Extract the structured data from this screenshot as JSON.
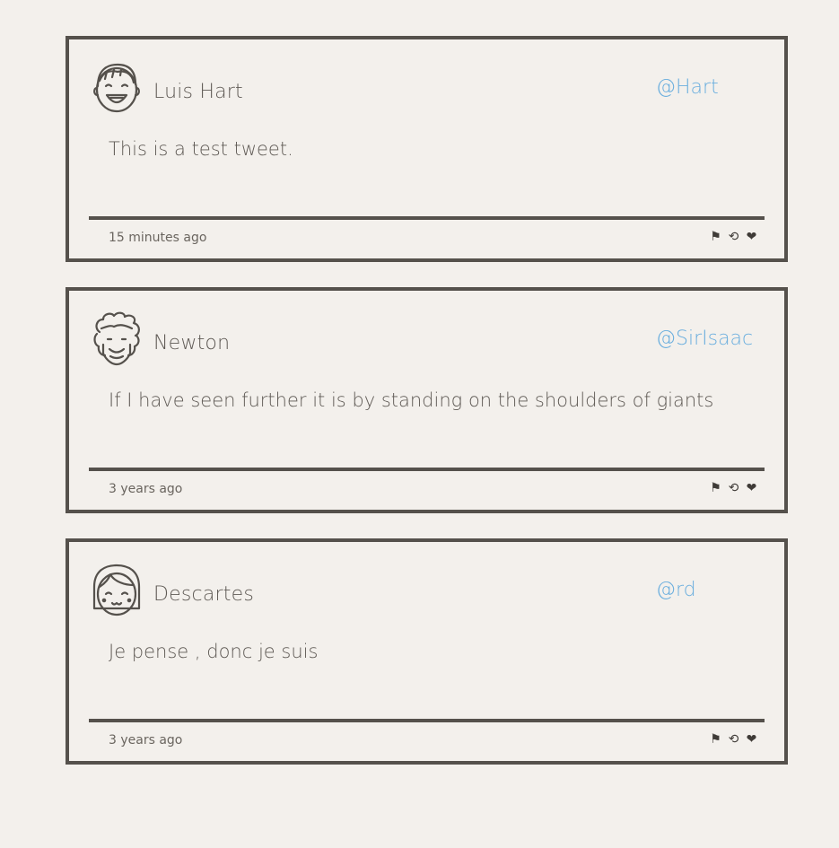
{
  "tweets": [
    {
      "name": "Luis Hart",
      "handle": "@Hart",
      "text": "This is a test tweet.",
      "time": "15 minutes ago",
      "avatar_icon": "smiling-man-avatar-icon"
    },
    {
      "name": "Newton",
      "handle": "@SirIsaac",
      "text": "If I have seen further it is by standing on the shoulders of giants",
      "time": "3 years ago",
      "avatar_icon": "curly-hair-man-avatar-icon"
    },
    {
      "name": "Descartes",
      "handle": "@rd",
      "text": "Je pense , donc je suis",
      "time": "3 years ago",
      "avatar_icon": "bob-hair-avatar-icon"
    }
  ],
  "actions": {
    "flag": "⚑",
    "retweet": "⟲",
    "like": "❤"
  },
  "colors": {
    "background": "#f3f0ec",
    "border": "#55514c",
    "handle": "#6aaede",
    "text": "#5f5a55"
  }
}
